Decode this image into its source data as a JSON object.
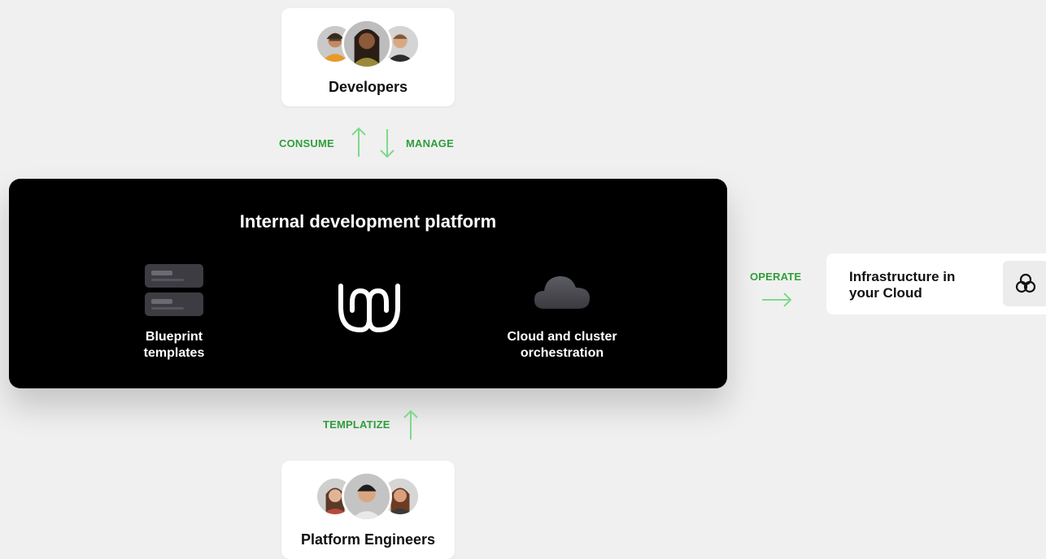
{
  "developers": {
    "label": "Developers",
    "avatar_icons": [
      "developer-avatar-1",
      "developer-avatar-2",
      "developer-avatar-3"
    ]
  },
  "platform_engineers": {
    "label": "Platform Engineers",
    "avatar_icons": [
      "engineer-avatar-1",
      "engineer-avatar-2",
      "engineer-avatar-3"
    ]
  },
  "flows": {
    "consume": "CONSUME",
    "manage": "MANAGE",
    "templatize": "TEMPLATIZE",
    "operate": "OPERATE"
  },
  "platform": {
    "title": "Internal development platform",
    "features": {
      "blueprint_line1": "Blueprint",
      "blueprint_line2": "templates",
      "cloud_line1": "Cloud and cluster",
      "cloud_line2": "orchestration"
    },
    "icons": [
      "blueprint-templates-icon",
      "platform-logo-icon",
      "cloud-icon"
    ]
  },
  "infrastructure": {
    "line1": "Infrastructure in",
    "line2": "your Cloud",
    "icon": "triple-ring-icon"
  },
  "colors": {
    "background": "#f0f0f0",
    "platform_bg": "#000000",
    "flow_text": "#2f9e3a",
    "arrow": "#7ed98a"
  }
}
